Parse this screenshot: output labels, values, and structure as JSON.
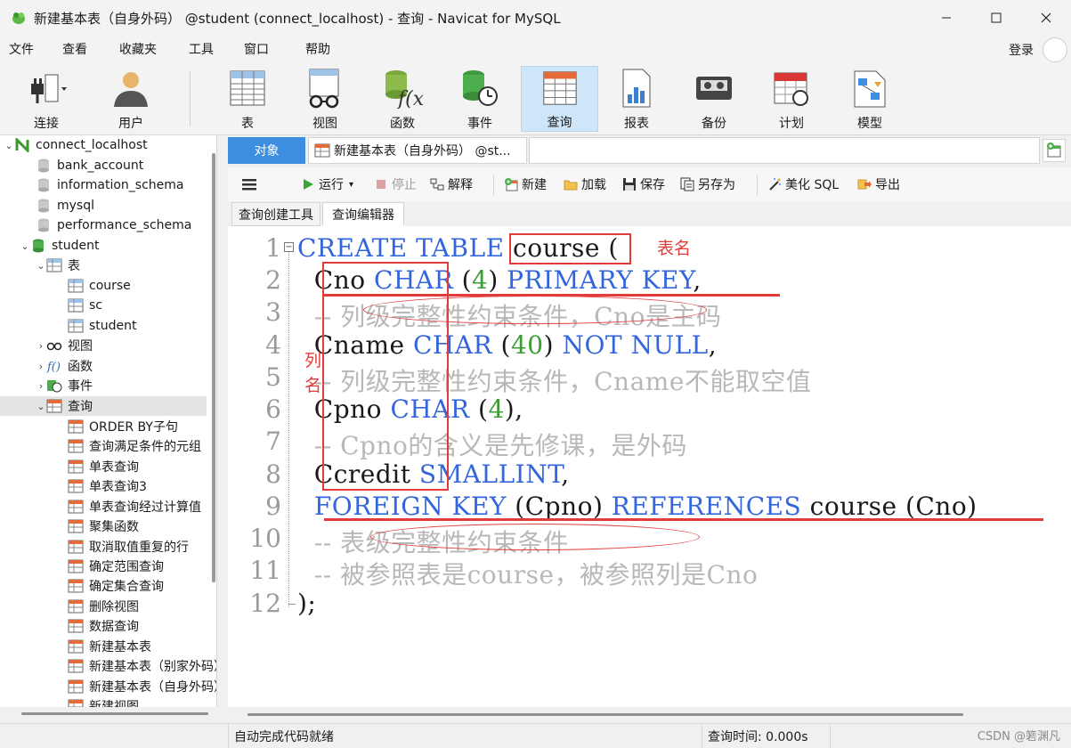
{
  "window": {
    "title": "新建基本表（自身外码） @student (connect_localhost) - 查询 - Navicat for MySQL",
    "controls": [
      "minimize",
      "maximize",
      "close"
    ]
  },
  "menu": [
    "文件",
    "查看",
    "收藏夹",
    "工具",
    "窗口",
    "帮助"
  ],
  "login_label": "登录",
  "toolbar": {
    "connect": "连接",
    "user": "用户",
    "table": "表",
    "view": "视图",
    "function": "函数",
    "event": "事件",
    "query": "查询",
    "report": "报表",
    "backup": "备份",
    "schedule": "计划",
    "model": "模型"
  },
  "sidebar": {
    "connection": "connect_localhost",
    "databases": [
      "bank_account",
      "information_schema",
      "mysql",
      "performance_schema"
    ],
    "current_db": "student",
    "tables_group": "表",
    "tables": [
      "course",
      "sc",
      "student"
    ],
    "views_group": "视图",
    "functions_group": "函数",
    "events_group": "事件",
    "queries_group": "查询",
    "queries": [
      "ORDER BY子句",
      "查询满足条件的元组",
      "单表查询",
      "单表查询3",
      "单表查询经过计算值",
      "聚集函数",
      "取消取值重复的行",
      "确定范围查询",
      "确定集合查询",
      "删除视图",
      "数据查询",
      "新建基本表",
      "新建基本表（别家外码）",
      "新建基本表（自身外码）",
      "新建视图"
    ]
  },
  "tabs": {
    "objects": "对象",
    "doc": "新建基本表（自身外码） @st..."
  },
  "query_toolbar": {
    "run": "运行",
    "stop": "停止",
    "explain": "解释",
    "new": "新建",
    "load": "加载",
    "save": "保存",
    "save_as": "另存为",
    "beautify": "美化 SQL",
    "export": "导出"
  },
  "subtabs": {
    "builder": "查询创建工具",
    "editor": "查询编辑器"
  },
  "code_lines": [
    "CREATE TABLE course (",
    "Cno CHAR (4) PRIMARY KEY,",
    "-- 列级完整性约束条件，Cno是主码",
    "Cname CHAR (40) NOT NULL,",
    "-- 列级完整性约束条件，Cname不能取空值",
    "Cpno CHAR (4),",
    "-- Cpno的含义是先修课，是外码",
    "Ccredit SMALLINT,",
    "FOREIGN KEY (Cpno) REFERENCES course (Cno)",
    "-- 表级完整性约束条件",
    "-- 被参照表是course，被参照列是Cno",
    ");"
  ],
  "line_numbers": [
    "1",
    "2",
    "3",
    "4",
    "5",
    "6",
    "7",
    "8",
    "9",
    "10",
    "11",
    "12"
  ],
  "annotations": {
    "table_name": "表名",
    "column_names_1": "列",
    "column_names_2": "名"
  },
  "status": {
    "message": "自动完成代码就绪",
    "query_time": "查询时间: 0.000s"
  },
  "watermark": "CSDN @箬渊凡",
  "colors": {
    "keyword": "#3366dd",
    "number": "#3a9e33",
    "comment": "#b8b8b8",
    "annotation": "#e23b3b",
    "active_tab": "#3d8ee1"
  }
}
